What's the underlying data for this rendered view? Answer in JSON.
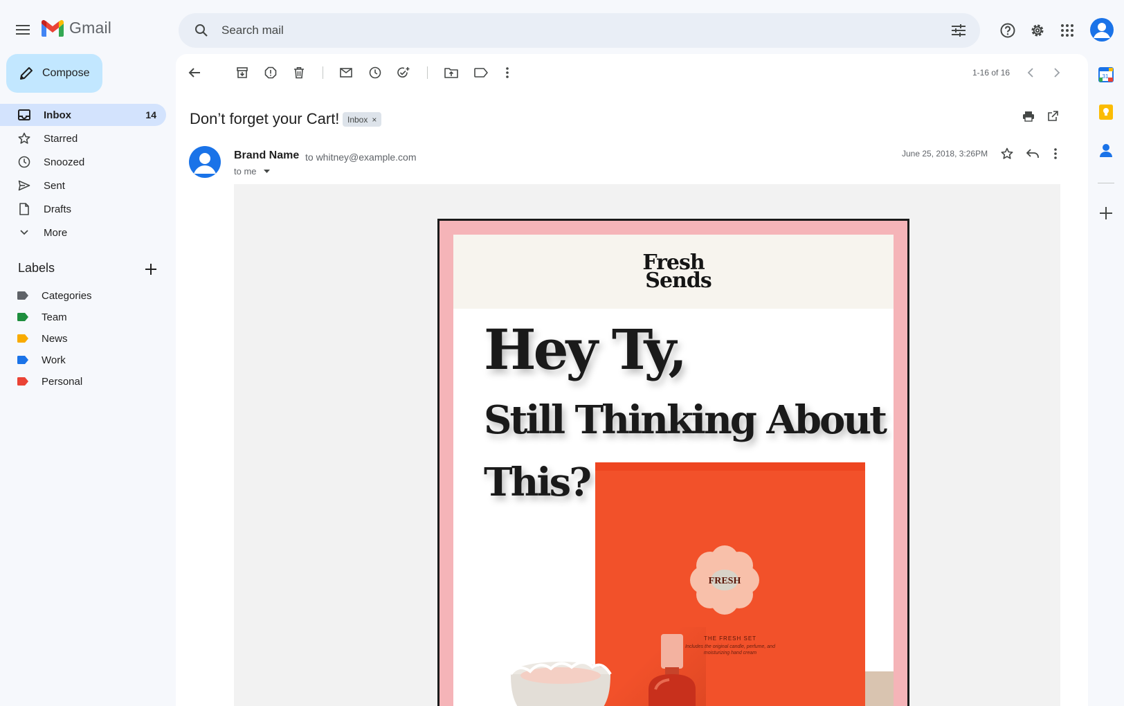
{
  "app": {
    "name": "Gmail"
  },
  "search": {
    "placeholder": "Search mail"
  },
  "compose": {
    "label": "Compose"
  },
  "nav": [
    {
      "label": "Inbox",
      "count": "14",
      "icon": "inbox-icon",
      "active": true
    },
    {
      "label": "Starred",
      "icon": "star-icon"
    },
    {
      "label": "Snoozed",
      "icon": "clock-icon"
    },
    {
      "label": "Sent",
      "icon": "send-icon"
    },
    {
      "label": "Drafts",
      "icon": "draft-icon"
    },
    {
      "label": "More",
      "icon": "chevron-down-icon"
    }
  ],
  "labels": {
    "title": "Labels",
    "items": [
      {
        "label": "Categories",
        "color": "#5f6368"
      },
      {
        "label": "Team",
        "color": "#1e8e3e"
      },
      {
        "label": "News",
        "color": "#f9ab00"
      },
      {
        "label": "Work",
        "color": "#1a73e8"
      },
      {
        "label": "Personal",
        "color": "#ea4335"
      }
    ]
  },
  "toolbar": {
    "pager": "1-16 of 16"
  },
  "message": {
    "subject": "Don’t forget your Cart!",
    "chip": "Inbox",
    "chip_close": "×",
    "sender_name": "Brand Name",
    "sender_to": "to whitney@example.com",
    "to_me": "to me",
    "date": "June 25, 2018, 3:26PM"
  },
  "email": {
    "brand_line1": "Fresh",
    "brand_line2": "Sends",
    "headline": "Hey Ty,",
    "subhead_1": "Still Thinking About",
    "subhead_2": "This?",
    "product_badge": "FRESH",
    "product_title": "THE FRESH SET",
    "product_sub": "Includes the original candle, perfume, and moisturizing hand cream"
  },
  "colors": {
    "accent": "#1a73e8",
    "compose_bg": "#c2e7ff",
    "active_nav": "#d3e3fd",
    "email_frame": "#f5b4b8",
    "product_box": "#f2512a"
  }
}
